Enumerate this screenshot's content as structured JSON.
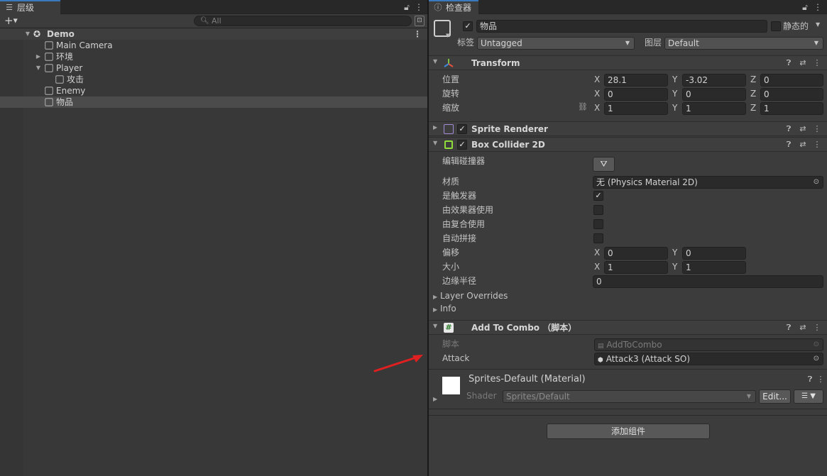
{
  "hierarchy": {
    "tab_label": "层级",
    "search_placeholder": "All",
    "scene": "Demo",
    "items": [
      {
        "label": "Main Camera"
      },
      {
        "label": "环境"
      },
      {
        "label": "Player"
      },
      {
        "label": "攻击"
      },
      {
        "label": "Enemy"
      },
      {
        "label": "物品"
      }
    ]
  },
  "inspector": {
    "tab_label": "检查器",
    "object_name": "物品",
    "static_label": "静态的",
    "tag_label": "标签",
    "tag_value": "Untagged",
    "layer_label": "图层",
    "layer_value": "Default",
    "transform": {
      "title": "Transform",
      "position_label": "位置",
      "rotation_label": "旋转",
      "scale_label": "缩放",
      "position": {
        "x": "28.1",
        "y": "-3.02",
        "z": "0"
      },
      "rotation": {
        "x": "0",
        "y": "0",
        "z": "0"
      },
      "scale": {
        "x": "1",
        "y": "1",
        "z": "1"
      }
    },
    "axis": {
      "x": "X",
      "y": "Y",
      "z": "Z"
    },
    "sprite_renderer": {
      "title": "Sprite Renderer"
    },
    "box_collider": {
      "title": "Box Collider 2D",
      "edit_label": "编辑碰撞器",
      "material_label": "材质",
      "material_value": "无 (Physics Material 2D)",
      "trigger_label": "是触发器",
      "effector_label": "由效果器使用",
      "composite_label": "由复合使用",
      "autotile_label": "自动拼接",
      "offset_label": "偏移",
      "offset": {
        "x": "0",
        "y": "0"
      },
      "size_label": "大小",
      "size": {
        "x": "1",
        "y": "1"
      },
      "edge_label": "边缘半径",
      "edge_value": "0",
      "layer_overrides": "Layer Overrides",
      "info": "Info"
    },
    "add_to_combo": {
      "title": "Add To Combo  （脚本）",
      "script_label": "脚本",
      "script_value": "AddToCombo",
      "attack_label": "Attack",
      "attack_value": "Attack3 (Attack SO)"
    },
    "material": {
      "title": "Sprites-Default (Material)",
      "shader_label": "Shader",
      "shader_value": "Sprites/Default",
      "edit_label": "Edit..."
    },
    "add_component": "添加组件"
  }
}
